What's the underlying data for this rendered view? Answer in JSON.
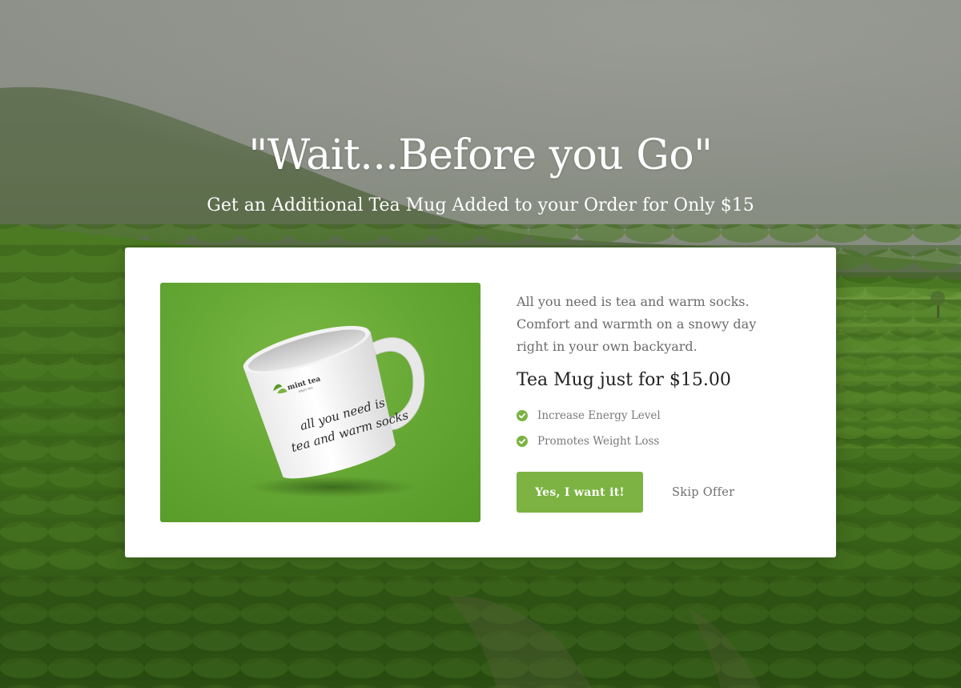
{
  "hero": {
    "headline": "\"Wait...Before you Go\"",
    "subheadline": "Get an Additional Tea Mug Added to your Order for Only $15",
    "background_image": "tea-plantation-hills-photo"
  },
  "offer": {
    "image_name": "mint-tea-mug-photo",
    "mug": {
      "brand": "mint tea",
      "tagline": "ENJOY TEA",
      "print_line_1": "all you need is",
      "print_line_2": "tea and warm socks"
    },
    "description": "All you need is tea and warm socks. Comfort and warmth on a snowy day right in your own backyard.",
    "price_title": "Tea Mug just for $15.00",
    "benefits": [
      {
        "label": "Increase Energy Level",
        "icon": "check-circle-icon"
      },
      {
        "label": "Promotes Weight Loss",
        "icon": "check-circle-icon"
      }
    ],
    "accept_label": "Yes, I want it!",
    "skip_label": "Skip Offer"
  },
  "colors": {
    "accent_green": "#7cb342",
    "card_background": "#ffffff",
    "body_text": "#6b6b6b",
    "title_text": "#222222"
  }
}
